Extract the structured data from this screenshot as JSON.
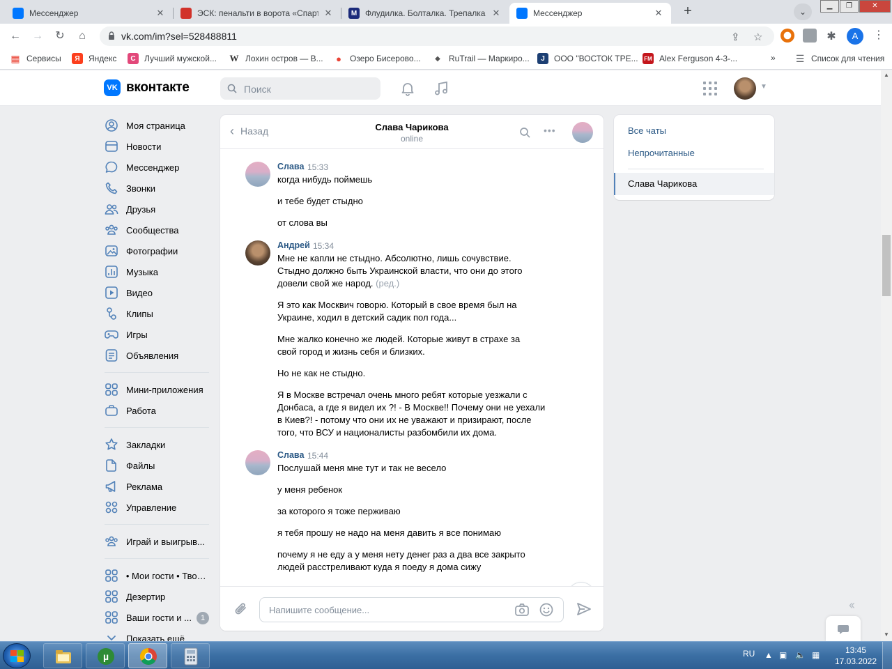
{
  "browser": {
    "tabs": [
      {
        "title": "Мессенджер",
        "icon": "vk-messenger-icon",
        "color": "#0077ff",
        "active": false
      },
      {
        "title": "ЭСК: пенальти в ворота «Спарта",
        "icon": "spartak-icon",
        "color": "#d1322a",
        "active": false
      },
      {
        "title": "Флудилка. Болталка. Трепалка -",
        "icon": "forum-m-icon",
        "color": "#1b2a7a",
        "active": false
      },
      {
        "title": "Мессенджер",
        "icon": "vk-messenger-icon",
        "color": "#0077ff",
        "active": true
      }
    ],
    "url": "vk.com/im?sel=528488811",
    "profile_initial": "A",
    "bookmarks": [
      {
        "label": "Сервисы",
        "icon": "apps-grid-icon",
        "color": "#ea4335"
      },
      {
        "label": "Яндекс",
        "icon": "yandex-icon",
        "color": "#fc3f1d"
      },
      {
        "label": "Лучший мужской...",
        "icon": "c-logo-icon",
        "color": "#e2487a"
      },
      {
        "label": "Лохин остров — В...",
        "icon": "wikipedia-icon",
        "color": "#333333"
      },
      {
        "label": "Озеро Бисерово...",
        "icon": "map-pin-icon",
        "color": "#ea4335"
      },
      {
        "label": "RuTrail — Маркиро...",
        "icon": "rutrail-icon",
        "color": "#555555"
      },
      {
        "label": "ООО \"ВОСТОК ТРЕ...",
        "icon": "j-logo-icon",
        "color": "#1c3f73"
      },
      {
        "label": "Alex Ferguson 4-3-...",
        "icon": "fm-logo-icon",
        "color": "#c4161c"
      }
    ],
    "bookmarks_overflow": "»",
    "reading_list": "Список для чтения"
  },
  "vk": {
    "logo_text": "вконтакте",
    "search_placeholder": "Поиск",
    "nav_groups": [
      [
        {
          "label": "Моя страница",
          "icon": "user-circle-icon"
        },
        {
          "label": "Новости",
          "icon": "news-icon"
        },
        {
          "label": "Мессенджер",
          "icon": "message-bubble-icon"
        },
        {
          "label": "Звонки",
          "icon": "phone-icon"
        },
        {
          "label": "Друзья",
          "icon": "friends-icon"
        },
        {
          "label": "Сообщества",
          "icon": "communities-icon"
        },
        {
          "label": "Фотографии",
          "icon": "photo-icon"
        },
        {
          "label": "Музыка",
          "icon": "music-icon"
        },
        {
          "label": "Видео",
          "icon": "video-icon"
        },
        {
          "label": "Клипы",
          "icon": "clips-icon"
        },
        {
          "label": "Игры",
          "icon": "gamepad-icon"
        },
        {
          "label": "Объявления",
          "icon": "classifieds-icon"
        }
      ],
      [
        {
          "label": "Мини-приложения",
          "icon": "mini-apps-icon"
        },
        {
          "label": "Работа",
          "icon": "briefcase-icon"
        }
      ],
      [
        {
          "label": "Закладки",
          "icon": "star-icon"
        },
        {
          "label": "Файлы",
          "icon": "file-icon"
        },
        {
          "label": "Реклама",
          "icon": "megaphone-icon"
        },
        {
          "label": "Управление",
          "icon": "manage-grid-icon"
        }
      ],
      [
        {
          "label": "Играй и выигрыв...",
          "icon": "communities-icon"
        }
      ],
      [
        {
          "label": "• Мои гости • Твои...",
          "icon": "app-grid-icon"
        },
        {
          "label": "Дезертир",
          "icon": "app-grid-icon"
        },
        {
          "label": "Ваши гости и ...",
          "icon": "app-grid-icon",
          "badge": "1"
        },
        {
          "label": "Показать ещё",
          "icon": "chevron-down-icon"
        }
      ]
    ]
  },
  "chat": {
    "back_label": "Назад",
    "peer_name": "Слава Чарикова",
    "peer_status": "online",
    "composer_placeholder": "Напишите сообщение...",
    "groups": [
      {
        "author": "Слава",
        "time": "15:33",
        "avatar": "sea-avatar",
        "paragraphs": [
          [
            "когда нибудь поймешь"
          ],
          [
            "и тебе будет стыдно"
          ],
          [
            "от слова вы"
          ]
        ]
      },
      {
        "author": "Андрей",
        "time": "15:34",
        "avatar": "photo-avatar",
        "paragraphs": [
          [
            "Мне не капли не стыдно. Абсолютно, лишь сочувствие.",
            "Стыдно должно быть Украинской власти, что они до этого",
            "довели свой же народ."
          ],
          [
            "Я это как Москвич говорю. Который в свое время был на",
            "Украине, ходил в детский садик пол года..."
          ],
          [
            "Мне жалко конечно же людей. Которые живут в страхе за",
            "свой город и жизнь себя и близких."
          ],
          [
            "Но не как не стыдно."
          ],
          [
            "Я в Москве встречал очень много ребят которые уезжали с",
            "Донбаса, а где я видел их ?! - В Москве!! Почему они не уехали",
            "в Киев?! - потому что они их не уважают и призирают, после",
            "того, что ВСУ и националисты разбомбили их дома."
          ]
        ],
        "edited_label": "(ред.)"
      },
      {
        "author": "Слава",
        "time": "15:44",
        "avatar": "sea-avatar",
        "paragraphs": [
          [
            "Послушай меня мне тут и так не весело"
          ],
          [
            "у меня ребенок"
          ],
          [
            "за которого я тоже перживаю"
          ],
          [
            "я тебя прошу не надо на меня давить я все понимаю"
          ],
          [
            "почему я не еду а у меня нету денег раз а два все закрыто",
            "людей расстреливают куда я поеду я дома сижу"
          ]
        ]
      }
    ]
  },
  "right_panel": {
    "all_chats": "Все чаты",
    "unread": "Непрочитанные",
    "active_chat": "Слава Чарикова"
  },
  "taskbar": {
    "apps": [
      "explorer-icon",
      "utorrent-icon",
      "chrome-icon",
      "calculator-icon"
    ],
    "language": "RU",
    "time": "13:45",
    "date": "17.03.2022"
  }
}
